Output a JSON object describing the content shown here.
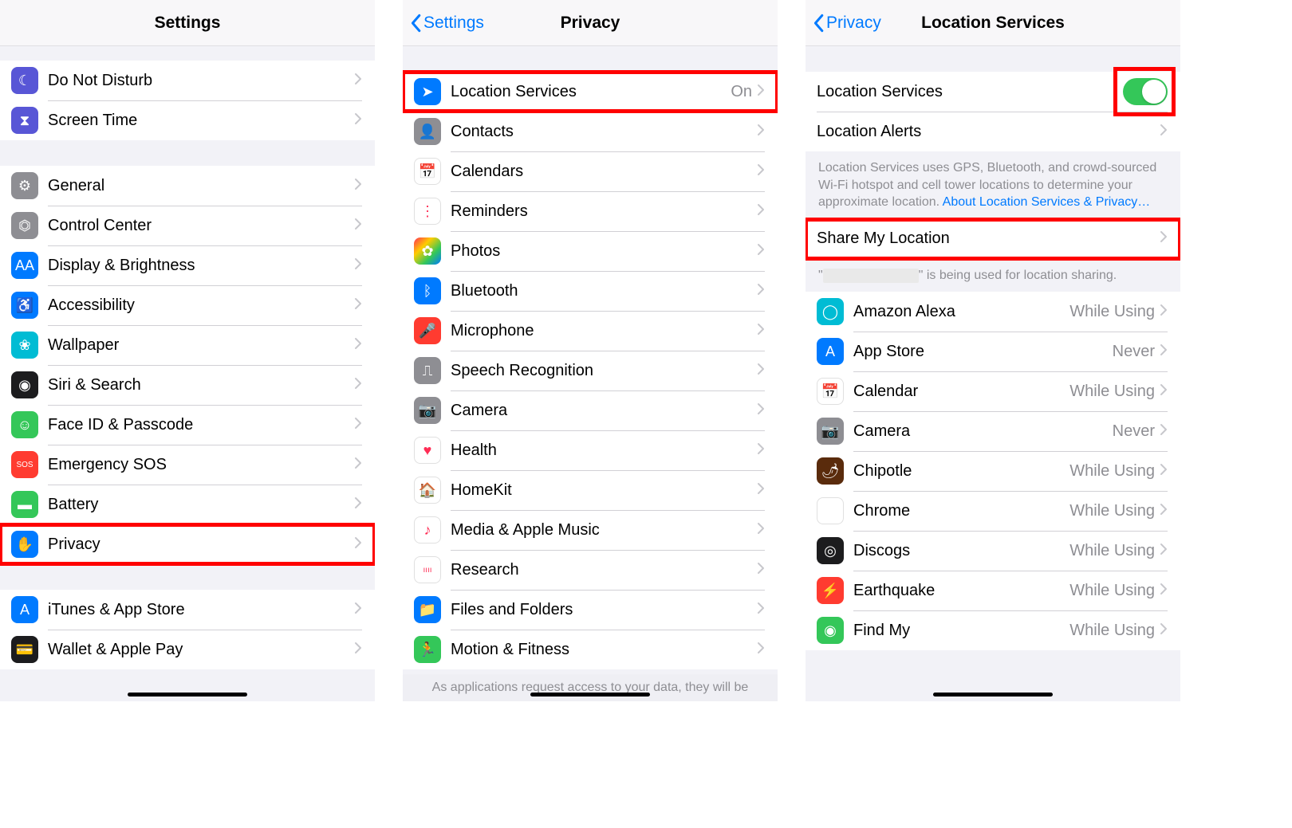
{
  "panel1": {
    "title": "Settings",
    "group1": [
      {
        "label": "Do Not Disturb",
        "icon": "moon-icon",
        "color": "ic-purple",
        "glyph": "☾"
      },
      {
        "label": "Screen Time",
        "icon": "hourglass-icon",
        "color": "ic-purple",
        "glyph": "⧗"
      }
    ],
    "group2": [
      {
        "label": "General",
        "icon": "gear-icon",
        "color": "ic-gray",
        "glyph": "⚙"
      },
      {
        "label": "Control Center",
        "icon": "switches-icon",
        "color": "ic-gray",
        "glyph": "⏣"
      },
      {
        "label": "Display & Brightness",
        "icon": "letters-icon",
        "color": "ic-blue",
        "glyph": "AA"
      },
      {
        "label": "Accessibility",
        "icon": "accessibility-icon",
        "color": "ic-blue",
        "glyph": "♿"
      },
      {
        "label": "Wallpaper",
        "icon": "flower-icon",
        "color": "ic-cyan",
        "glyph": "❀"
      },
      {
        "label": "Siri & Search",
        "icon": "siri-icon",
        "color": "ic-dark",
        "glyph": "◉"
      },
      {
        "label": "Face ID & Passcode",
        "icon": "faceid-icon",
        "color": "ic-green",
        "glyph": "☺"
      },
      {
        "label": "Emergency SOS",
        "icon": "sos-icon",
        "color": "ic-red",
        "glyph": "SOS"
      },
      {
        "label": "Battery",
        "icon": "battery-icon",
        "color": "ic-green",
        "glyph": "▬"
      },
      {
        "label": "Privacy",
        "icon": "hand-icon",
        "color": "ic-blue",
        "glyph": "✋",
        "highlight": true
      }
    ],
    "group3": [
      {
        "label": "iTunes & App Store",
        "icon": "appstore-icon",
        "color": "ic-blue",
        "glyph": "A"
      },
      {
        "label": "Wallet & Apple Pay",
        "icon": "wallet-icon",
        "color": "ic-dark",
        "glyph": "💳"
      }
    ]
  },
  "panel2": {
    "back": "Settings",
    "title": "Privacy",
    "items": [
      {
        "label": "Location Services",
        "icon": "location-icon",
        "color": "ic-blue",
        "glyph": "➤",
        "detail": "On",
        "highlight": true
      },
      {
        "label": "Contacts",
        "icon": "contacts-icon",
        "color": "ic-gray",
        "glyph": "👤"
      },
      {
        "label": "Calendars",
        "icon": "calendar-icon",
        "color": "ic-white",
        "glyph": "📅"
      },
      {
        "label": "Reminders",
        "icon": "reminders-icon",
        "color": "ic-white",
        "glyph": "⋮"
      },
      {
        "label": "Photos",
        "icon": "photos-icon",
        "color": "ic-multi",
        "glyph": "✿"
      },
      {
        "label": "Bluetooth",
        "icon": "bluetooth-icon",
        "color": "ic-blue",
        "glyph": "ᛒ"
      },
      {
        "label": "Microphone",
        "icon": "microphone-icon",
        "color": "ic-red",
        "glyph": "🎤"
      },
      {
        "label": "Speech Recognition",
        "icon": "waveform-icon",
        "color": "ic-gray",
        "glyph": "⎍"
      },
      {
        "label": "Camera",
        "icon": "camera-icon",
        "color": "ic-gray",
        "glyph": "📷"
      },
      {
        "label": "Health",
        "icon": "health-icon",
        "color": "ic-white",
        "glyph": "♥"
      },
      {
        "label": "HomeKit",
        "icon": "home-icon",
        "color": "ic-white",
        "glyph": "🏠"
      },
      {
        "label": "Media & Apple Music",
        "icon": "music-icon",
        "color": "ic-white",
        "glyph": "♪"
      },
      {
        "label": "Research",
        "icon": "research-icon",
        "color": "ic-white",
        "glyph": "ıııı"
      },
      {
        "label": "Files and Folders",
        "icon": "folder-icon",
        "color": "ic-blue",
        "glyph": "📁"
      },
      {
        "label": "Motion & Fitness",
        "icon": "motion-icon",
        "color": "ic-green",
        "glyph": "🏃"
      }
    ],
    "footer": "As applications request access to your data, they will be"
  },
  "panel3": {
    "back": "Privacy",
    "title": "Location Services",
    "toggle_label": "Location Services",
    "toggle_on": true,
    "alerts_label": "Location Alerts",
    "info_text": "Location Services uses GPS, Bluetooth, and crowd-sourced Wi-Fi hotspot and cell tower locations to determine your approximate location. ",
    "info_link": "About Location Services & Privacy…",
    "share_label": "Share My Location",
    "share_note_prefix": "\"",
    "share_note_suffix": "\" is being used for location sharing.",
    "apps": [
      {
        "label": "Amazon Alexa",
        "icon": "alexa-icon",
        "color": "ic-cyan",
        "glyph": "◯",
        "detail": "While Using"
      },
      {
        "label": "App Store",
        "icon": "appstore-icon",
        "color": "ic-blue",
        "glyph": "A",
        "detail": "Never"
      },
      {
        "label": "Calendar",
        "icon": "calendar-icon",
        "color": "ic-white",
        "glyph": "📅",
        "detail": "While Using"
      },
      {
        "label": "Camera",
        "icon": "camera-icon",
        "color": "ic-gray",
        "glyph": "📷",
        "detail": "Never"
      },
      {
        "label": "Chipotle",
        "icon": "chipotle-icon",
        "color": "ic-brown",
        "glyph": "🌶",
        "detail": "While Using"
      },
      {
        "label": "Chrome",
        "icon": "chrome-icon",
        "color": "ic-chrome",
        "glyph": "◉",
        "detail": "While Using"
      },
      {
        "label": "Discogs",
        "icon": "discogs-icon",
        "color": "ic-dark",
        "glyph": "◎",
        "detail": "While Using"
      },
      {
        "label": "Earthquake",
        "icon": "earthquake-icon",
        "color": "ic-red",
        "glyph": "⚡",
        "detail": "While Using"
      },
      {
        "label": "Find My",
        "icon": "findmy-icon",
        "color": "ic-green",
        "glyph": "◉",
        "detail": "While Using"
      }
    ]
  }
}
